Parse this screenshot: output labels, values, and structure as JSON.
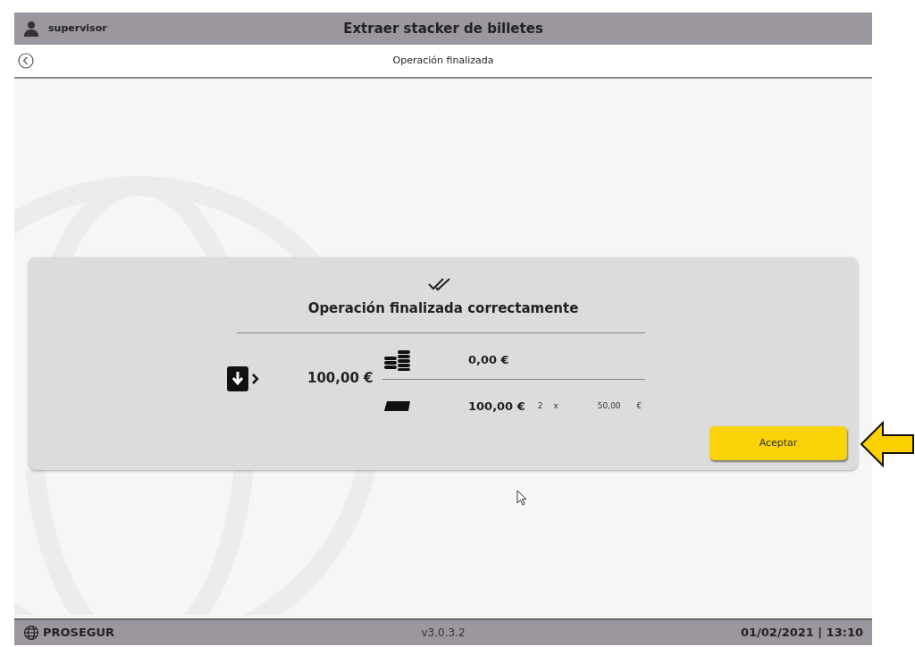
{
  "header": {
    "user": "supervisor",
    "title": "Extraer stacker de billetes"
  },
  "subheader": {
    "title": "Operación finalizada"
  },
  "result": {
    "message": "Operación finalizada correctamente",
    "total": "100,00 €",
    "rows": [
      {
        "kind": "coins",
        "amount": "0,00 €"
      },
      {
        "kind": "notes",
        "amount": "100,00 €",
        "count": "2",
        "times": "x",
        "denomination": "50,00",
        "currency": "€"
      }
    ]
  },
  "accept_button": "Aceptar",
  "footer": {
    "brand": "PROSEGUR",
    "version": "v3.0.3.2",
    "datetime": "01/02/2021 | 13:10"
  }
}
